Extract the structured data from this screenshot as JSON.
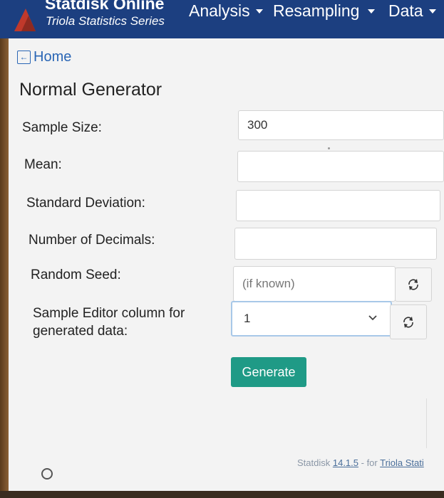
{
  "navbar": {
    "brand_title": "Statdisk Online",
    "brand_subtitle": "Triola Statistics Series",
    "menus": [
      {
        "label": "Analysis"
      },
      {
        "label": "Resampling"
      },
      {
        "label": "Data"
      }
    ]
  },
  "home_link": "Home",
  "page_title": "Normal Generator",
  "form": {
    "sample_size": {
      "label": "Sample Size:",
      "value": "300"
    },
    "mean": {
      "label": "Mean:",
      "value": ""
    },
    "std_dev": {
      "label": "Standard Deviation:",
      "value": ""
    },
    "decimals": {
      "label": "Number of Decimals:",
      "value": ""
    },
    "seed": {
      "label": "Random Seed:",
      "placeholder": "(if known)"
    },
    "column": {
      "label_line1": "Sample Editor column for",
      "label_line2": "generated data:",
      "selected": "1"
    }
  },
  "generate_label": "Generate",
  "footer": {
    "prefix": "Statdisk ",
    "version": "14.1.5",
    "mid": " - for ",
    "link": "Triola Stati"
  },
  "colors": {
    "navbar": "#1c3f80",
    "generate": "#1f9a86",
    "link": "#2a66b5"
  }
}
